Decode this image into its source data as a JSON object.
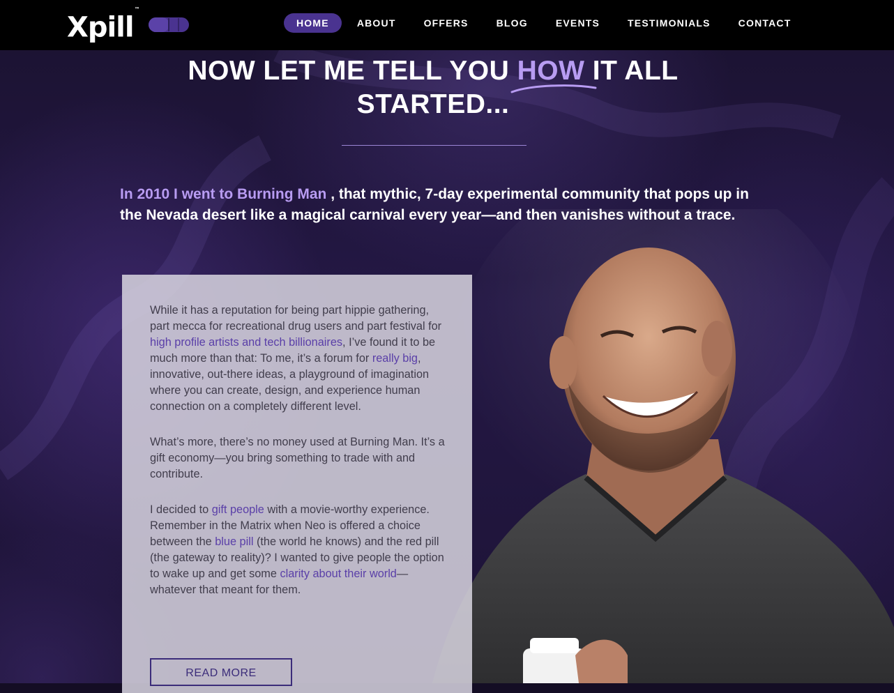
{
  "brand": {
    "logo_text": "Xpill",
    "trademark": "™",
    "pill_color": "#4a3390"
  },
  "nav": {
    "items": [
      {
        "label": "HOME",
        "active": true
      },
      {
        "label": "ABOUT",
        "active": false
      },
      {
        "label": "OFFERS",
        "active": false
      },
      {
        "label": "BLOG",
        "active": false
      },
      {
        "label": "EVENTS",
        "active": false
      },
      {
        "label": "TESTIMONIALS",
        "active": false
      },
      {
        "label": "CONTACT",
        "active": false
      }
    ]
  },
  "headline": {
    "part1": "NOW LET ME TELL YOU ",
    "highlight": "HOW",
    "part2": " IT ALL",
    "line2": "STARTED..."
  },
  "intro": {
    "lead": "In 2010 I went to Burning Man",
    "rest": " , that mythic, 7-day experimental community that pops up in the Nevada desert like a magical carnival every year—and then vanishes without a trace."
  },
  "card": {
    "p1": {
      "t1": "While it has a reputation for being part hippie gathering, part mecca for recreational drug users and part festival for ",
      "l1": "high profile artists and tech billionaires",
      "t2": ", I’ve found it to be much more than that: To me, it’s a forum for ",
      "l2": "really big",
      "t3": ", innovative, out-there ideas, a playground of imagination where you can create, design, and experience human connection on a completely different level."
    },
    "p2": "What’s more, there’s no money used at Burning Man. It’s a gift economy—you bring something to trade with and contribute.",
    "p3": {
      "t1": "I decided to ",
      "l1": "gift people",
      "t2": " with a movie-worthy experience. Remember in the Matrix when Neo is offered a choice between the ",
      "l2": "blue pill",
      "t3": " (the world he knows) and the red pill (the gateway to reality)? I wanted to give people the option to wake up and get some ",
      "l3": "clarity about their world",
      "t4": "—whatever that meant for them."
    },
    "button_label": "READ MORE"
  },
  "colors": {
    "accent": "#b89cf2",
    "nav_active": "#4a3390",
    "link": "#5a3fa8",
    "button_border": "#3b2c7a"
  }
}
